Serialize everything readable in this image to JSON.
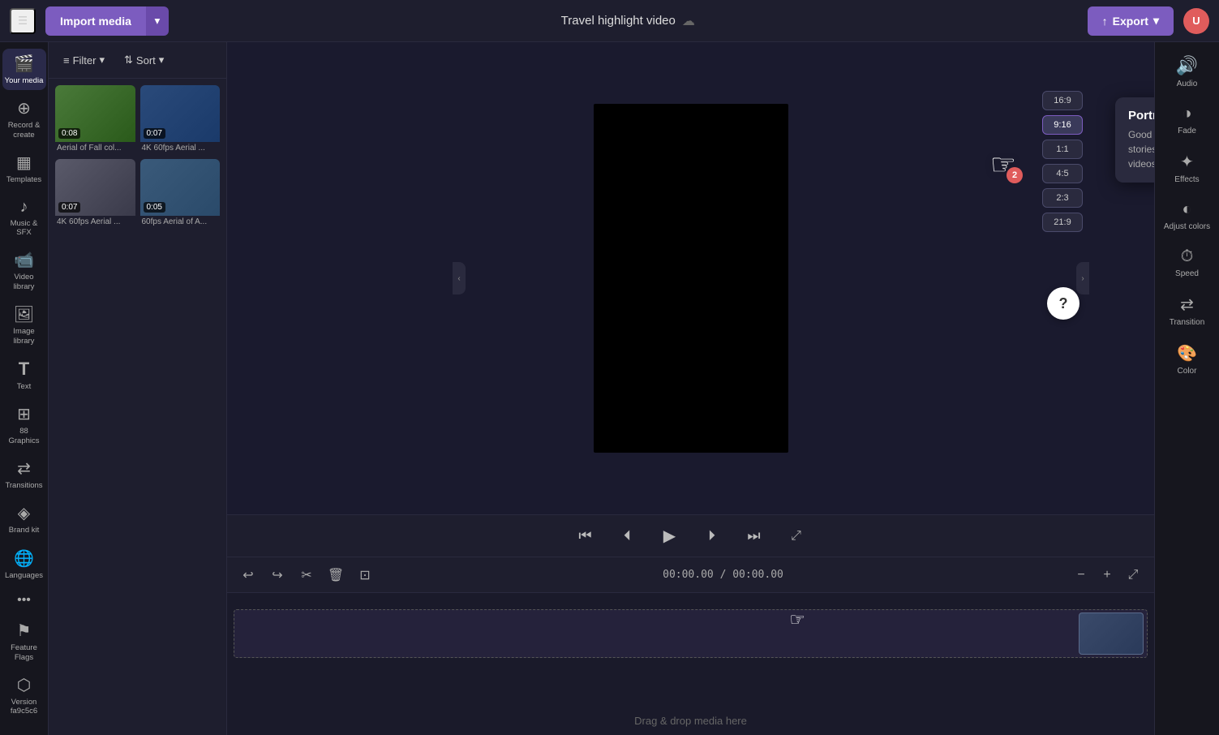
{
  "topbar": {
    "menu_label": "☰",
    "import_label": "Import media",
    "import_arrow": "▾",
    "project_title": "Travel highlight video",
    "cloud_icon": "☁",
    "export_label": "Export",
    "export_icon": "↑",
    "avatar_initials": "U"
  },
  "sidebar": {
    "items": [
      {
        "id": "your-media",
        "icon": "🎬",
        "label": "Your media",
        "active": true
      },
      {
        "id": "record-create",
        "icon": "⊕",
        "label": "Record &\ncreate"
      },
      {
        "id": "templates",
        "icon": "▦",
        "label": "Templates"
      },
      {
        "id": "music-sfx",
        "icon": "♪",
        "label": "Music & SFX"
      },
      {
        "id": "video-library",
        "icon": "📹",
        "label": "Video library"
      },
      {
        "id": "image-library",
        "icon": "🖼",
        "label": "Image library"
      },
      {
        "id": "text",
        "icon": "T",
        "label": "Text"
      },
      {
        "id": "graphics",
        "icon": "⊞",
        "label": "88 Graphics"
      },
      {
        "id": "transitions",
        "icon": "⇄",
        "label": "Transitions"
      },
      {
        "id": "brand-kit",
        "icon": "◈",
        "label": "Brand kit"
      },
      {
        "id": "languages",
        "icon": "🌐",
        "label": "Languages"
      },
      {
        "id": "feature-flags",
        "icon": "⚑",
        "label": "Feature Flags"
      },
      {
        "id": "version",
        "icon": "⬡",
        "label": "Version\nfa9c5c6"
      }
    ]
  },
  "panel": {
    "filter_label": "Filter",
    "filter_icon": "▼",
    "sort_label": "Sort",
    "sort_icon": "⇅"
  },
  "media_items": [
    {
      "id": "m1",
      "duration": "0:08",
      "name": "Aerial of Fall col...",
      "color": "green"
    },
    {
      "id": "m2",
      "duration": "0:07",
      "name": "4K 60fps Aerial ...",
      "color": "blue"
    },
    {
      "id": "m3",
      "duration": "0:07",
      "name": "4K 60fps Aerial ...",
      "color": "grey"
    },
    {
      "id": "m4",
      "duration": "0:05",
      "name": "60fps Aerial of A...",
      "color": "blue"
    }
  ],
  "playback": {
    "skip_back": "⏮",
    "step_back": "⏪",
    "play": "▶",
    "step_forward": "⏩",
    "skip_forward": "⏭"
  },
  "timeline": {
    "undo": "↩",
    "redo": "↪",
    "cut": "✂",
    "delete": "🗑",
    "duplicate": "⊡",
    "time_current": "00:00.00",
    "time_total": "00:00.00",
    "separator": "/",
    "zoom_out": "−",
    "zoom_in": "+",
    "zoom_fit": "⤢",
    "drop_label": "Drag & drop media here"
  },
  "right_tools": [
    {
      "id": "audio",
      "icon": "🔊",
      "label": "Audio"
    },
    {
      "id": "fade",
      "icon": "◑",
      "label": "Fade"
    },
    {
      "id": "effects",
      "icon": "✦",
      "label": "Effects"
    },
    {
      "id": "adjust-colors",
      "icon": "◐",
      "label": "Adjust colors"
    },
    {
      "id": "speed",
      "icon": "⏱",
      "label": "Speed"
    },
    {
      "id": "transition",
      "icon": "⇄",
      "label": "Transition"
    },
    {
      "id": "color",
      "icon": "🎨",
      "label": "Color"
    }
  ],
  "aspect_ratios": [
    {
      "id": "16-9",
      "label": "16:9"
    },
    {
      "id": "9-16",
      "label": "9:16",
      "active": true
    },
    {
      "id": "1-1",
      "label": "1:1"
    },
    {
      "id": "4-5",
      "label": "4:5"
    },
    {
      "id": "2-3",
      "label": "2:3"
    },
    {
      "id": "21-9",
      "label": "21:9"
    }
  ],
  "portrait_popup": {
    "title": "Portrait",
    "description": "Good for Instagram stories, IGTV and mobile videos"
  }
}
